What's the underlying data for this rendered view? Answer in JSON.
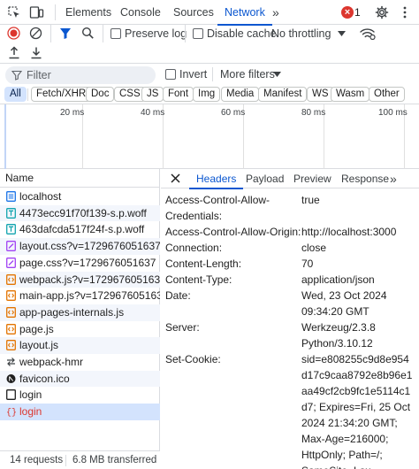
{
  "top_tabs": [
    {
      "label": "Elements"
    },
    {
      "label": "Console"
    },
    {
      "label": "Sources"
    },
    {
      "label": "Network"
    }
  ],
  "error_count": "1",
  "toolbar": {
    "preserve_log": "Preserve log",
    "disable_cache": "Disable cache",
    "throttling": "No throttling"
  },
  "filter": {
    "placeholder": "Filter",
    "invert": "Invert",
    "more_filters": "More filters"
  },
  "type_chips": [
    "All",
    "Fetch/XHR",
    "Doc",
    "CSS",
    "JS",
    "Font",
    "Img",
    "Media",
    "Manifest",
    "WS",
    "Wasm",
    "Other"
  ],
  "timeline_ticks": [
    "20 ms",
    "40 ms",
    "60 ms",
    "80 ms",
    "100 ms"
  ],
  "list_header": "Name",
  "requests": [
    {
      "name": "localhost",
      "icon": "document-icon"
    },
    {
      "name": "4473ecc91f70f139-s.p.woff",
      "icon": "font-icon"
    },
    {
      "name": "463dafcda517f24f-s.p.woff",
      "icon": "font-icon"
    },
    {
      "name": "layout.css?v=1729676051637",
      "icon": "stylesheet-icon"
    },
    {
      "name": "page.css?v=1729676051637",
      "icon": "stylesheet-icon"
    },
    {
      "name": "webpack.js?v=1729676051637",
      "icon": "script-icon"
    },
    {
      "name": "main-app.js?v=1729676051637",
      "icon": "script-icon"
    },
    {
      "name": "app-pages-internals.js",
      "icon": "script-icon"
    },
    {
      "name": "page.js",
      "icon": "script-icon"
    },
    {
      "name": "layout.js",
      "icon": "script-icon"
    },
    {
      "name": "webpack-hmr",
      "icon": "websocket-icon"
    },
    {
      "name": "favicon.ico",
      "icon": "favicon-icon"
    },
    {
      "name": "login",
      "icon": "blank-icon"
    },
    {
      "name": "login",
      "icon": "fetch-error-icon"
    }
  ],
  "status": {
    "requests": "14 requests",
    "transferred": "6.8 MB transferred"
  },
  "detail_tabs": [
    "Headers",
    "Payload",
    "Preview",
    "Response"
  ],
  "headers": [
    {
      "k": [
        "Access-Control-Allow-",
        "Credentials:"
      ],
      "v": [
        "true"
      ]
    },
    {
      "k": [
        "Access-Control-Allow-Origin:"
      ],
      "v": [
        "http://localhost:3000"
      ]
    },
    {
      "k": [
        "Connection:"
      ],
      "v": [
        "close"
      ]
    },
    {
      "k": [
        "Content-Length:"
      ],
      "v": [
        "70"
      ]
    },
    {
      "k": [
        "Content-Type:"
      ],
      "v": [
        "application/json"
      ]
    },
    {
      "k": [
        "Date:"
      ],
      "v": [
        "Wed, 23 Oct 2024",
        "09:34:20 GMT"
      ]
    },
    {
      "k": [
        "Server:"
      ],
      "v": [
        "Werkzeug/2.3.8",
        "Python/3.10.12"
      ]
    },
    {
      "k": [
        "Set-Cookie:"
      ],
      "v": [
        "sid=e808255c9d8e954",
        "d17c9caa8792e8b96e1",
        "aa49cf2cb9fc1e5114c1",
        "d7; Expires=Fri, 25 Oct",
        "2024 21:34:20 GMT;",
        "Max-Age=216000;",
        "HttpOnly; Path=/;",
        "SameSite=Lax"
      ]
    }
  ],
  "colors": {
    "accent": "#0b57d0",
    "error": "#dc362e",
    "selected_row": "#d3e3fd"
  }
}
